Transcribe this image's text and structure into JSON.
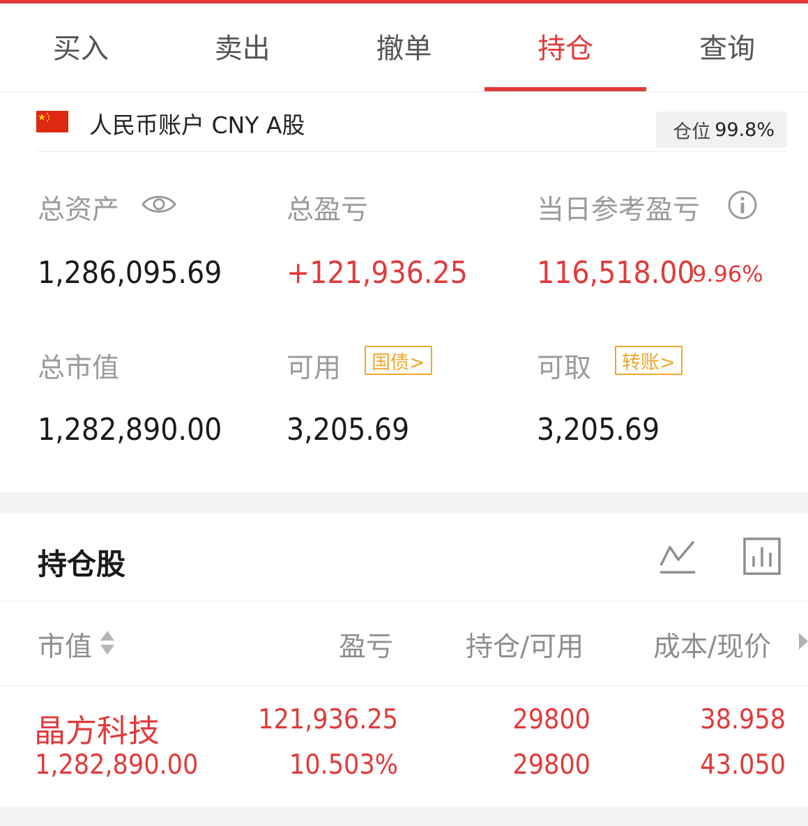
{
  "tabs": [
    {
      "label": "买入",
      "active": false
    },
    {
      "label": "卖出",
      "active": false
    },
    {
      "label": "撤单",
      "active": false
    },
    {
      "label": "持仓",
      "active": true
    },
    {
      "label": "查询",
      "active": false
    }
  ],
  "account": {
    "flag_icon": "china-flag-icon",
    "label": "人民币账户 CNY A股",
    "position_label": "仓位",
    "position_value": "99.8%"
  },
  "metrics": {
    "total_assets": {
      "label": "总资产",
      "value": "1,286,095.69",
      "icon": "eye-icon"
    },
    "total_pnl": {
      "label": "总盈亏",
      "value": "+121,936.25"
    },
    "daily_pnl": {
      "label": "当日参考盈亏",
      "value": "116,518.00",
      "percent": "9.96%",
      "icon": "info-icon"
    },
    "market_value": {
      "label": "总市值",
      "value": "1,282,890.00"
    },
    "available": {
      "label": "可用",
      "value": "3,205.69",
      "tag": "国债>"
    },
    "withdrawable": {
      "label": "可取",
      "value": "3,205.69",
      "tag": "转账>"
    }
  },
  "holdings": {
    "title": "持仓股",
    "columns": [
      "市值",
      "盈亏",
      "持仓/可用",
      "成本/现价"
    ],
    "rows": [
      {
        "name": "晶方科技",
        "market_value": "1,282,890.00",
        "pnl": "121,936.25",
        "pnl_pct": "10.503%",
        "position": "29800",
        "available": "29800",
        "cost": "38.958",
        "price": "43.050"
      }
    ]
  },
  "colors": {
    "accent": "#e03a3a",
    "tag": "#f0a629",
    "muted": "#9a9a9a"
  }
}
